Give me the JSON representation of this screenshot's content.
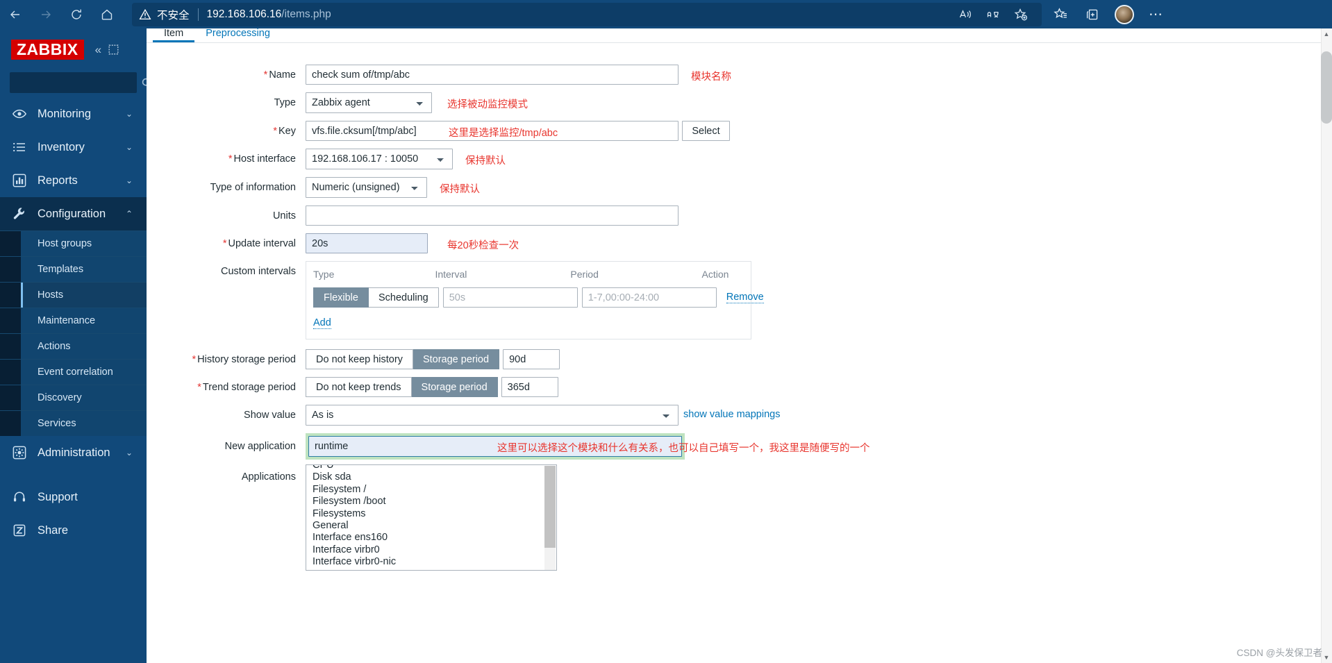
{
  "browser": {
    "nav": {
      "back_icon": "arrow-left-icon",
      "forward_icon": "arrow-right-icon",
      "refresh_icon": "refresh-icon",
      "home_icon": "home-icon"
    },
    "address": {
      "security_icon": "warning-triangle-icon",
      "security_label": "不安全",
      "host": "192.168.106.16",
      "path": "/items.php"
    },
    "toolbar": {
      "read_aloud_icon": "read-aloud-icon",
      "translate_icon": "translate-icon",
      "add_favorite_icon": "add-favorite-icon",
      "favorites_icon": "favorites-star-list-icon",
      "collections_icon": "collections-add-icon",
      "profile_icon": "profile-avatar-icon",
      "settings_icon": "more-options-icon",
      "settings_label": "⋯"
    }
  },
  "sidebar": {
    "logo": "ZABBIX",
    "collapse_label": "«",
    "collapse_icon": "collapse-sidebar-icon",
    "fullscreen_icon": "expand-fullscreen-icon",
    "search": {
      "value": "",
      "placeholder": "",
      "icon": "search-icon"
    },
    "groups": [
      {
        "label": "Monitoring",
        "icon": "eye-icon",
        "expanded": false,
        "chevron": "⌄"
      },
      {
        "label": "Inventory",
        "icon": "list-icon",
        "expanded": false,
        "chevron": "⌄"
      },
      {
        "label": "Reports",
        "icon": "bar-chart-icon",
        "expanded": false,
        "chevron": "⌄"
      },
      {
        "label": "Configuration",
        "icon": "wrench-icon",
        "expanded": true,
        "chevron": "⌃"
      },
      {
        "label": "Administration",
        "icon": "gear-icon",
        "expanded": false,
        "chevron": "⌄"
      }
    ],
    "configuration_items": [
      {
        "label": "Host groups",
        "selected": false
      },
      {
        "label": "Templates",
        "selected": false
      },
      {
        "label": "Hosts",
        "selected": true
      },
      {
        "label": "Maintenance",
        "selected": false
      },
      {
        "label": "Actions",
        "selected": false
      },
      {
        "label": "Event correlation",
        "selected": false
      },
      {
        "label": "Discovery",
        "selected": false
      },
      {
        "label": "Services",
        "selected": false
      }
    ],
    "footer_items": [
      {
        "label": "Support",
        "icon": "headset-icon"
      },
      {
        "label": "Share",
        "icon": "zabbix-z-icon"
      }
    ]
  },
  "tabs": [
    {
      "label": "Item",
      "active": true
    },
    {
      "label": "Preprocessing",
      "active": false
    }
  ],
  "form": {
    "name": {
      "label": "Name",
      "required": true,
      "value": "check sum of/tmp/abc",
      "placeholder": "",
      "note": "模块名称"
    },
    "type": {
      "label": "Type",
      "required": false,
      "value": "Zabbix agent",
      "note": "选择被动监控模式"
    },
    "key": {
      "label": "Key",
      "required": true,
      "value": "vfs.file.cksum[/tmp/abc]",
      "placeholder": "",
      "select_button": "Select",
      "note": "这里是选择监控/tmp/abc"
    },
    "host_interface": {
      "label": "Host interface",
      "required": true,
      "value": "192.168.106.17 : 10050",
      "note": "保持默认"
    },
    "type_of_information": {
      "label": "Type of information",
      "required": false,
      "value": "Numeric (unsigned)",
      "note": "保持默认"
    },
    "units": {
      "label": "Units",
      "required": false,
      "value": "",
      "placeholder": ""
    },
    "update_interval": {
      "label": "Update interval",
      "required": true,
      "value": "20s",
      "note": "每20秒检查一次"
    },
    "custom_intervals": {
      "label": "Custom intervals",
      "columns": [
        "Type",
        "Interval",
        "Period",
        "Action"
      ],
      "rows": [
        {
          "type_options": [
            "Flexible",
            "Scheduling"
          ],
          "type_selected": "Flexible",
          "interval_value": "",
          "interval_placeholder": "50s",
          "period_value": "",
          "period_placeholder": "1-7,00:00-24:00",
          "action": "Remove"
        }
      ],
      "add_label": "Add"
    },
    "history_storage_period": {
      "label": "History storage period",
      "required": true,
      "options": [
        "Do not keep history",
        "Storage period"
      ],
      "selected": "Storage period",
      "value": "90d"
    },
    "trend_storage_period": {
      "label": "Trend storage period",
      "required": true,
      "options": [
        "Do not keep trends",
        "Storage period"
      ],
      "selected": "Storage period",
      "value": "365d"
    },
    "show_value": {
      "label": "Show value",
      "required": false,
      "value": "As is",
      "link": "show value mappings"
    },
    "new_application": {
      "label": "New application",
      "required": false,
      "value": "runtime",
      "placeholder": "",
      "note": "这里可以选择这个模块和什么有关系，也可以自己填写一个，我这里是随便写的一个"
    },
    "applications": {
      "label": "Applications",
      "items": [
        "CPU",
        "Disk sda",
        "Filesystem /",
        "Filesystem /boot",
        "Filesystems",
        "General",
        "Interface ens160",
        "Interface virbr0",
        "Interface virbr0-nic"
      ]
    }
  },
  "watermark": "CSDN @头发保卫者"
}
